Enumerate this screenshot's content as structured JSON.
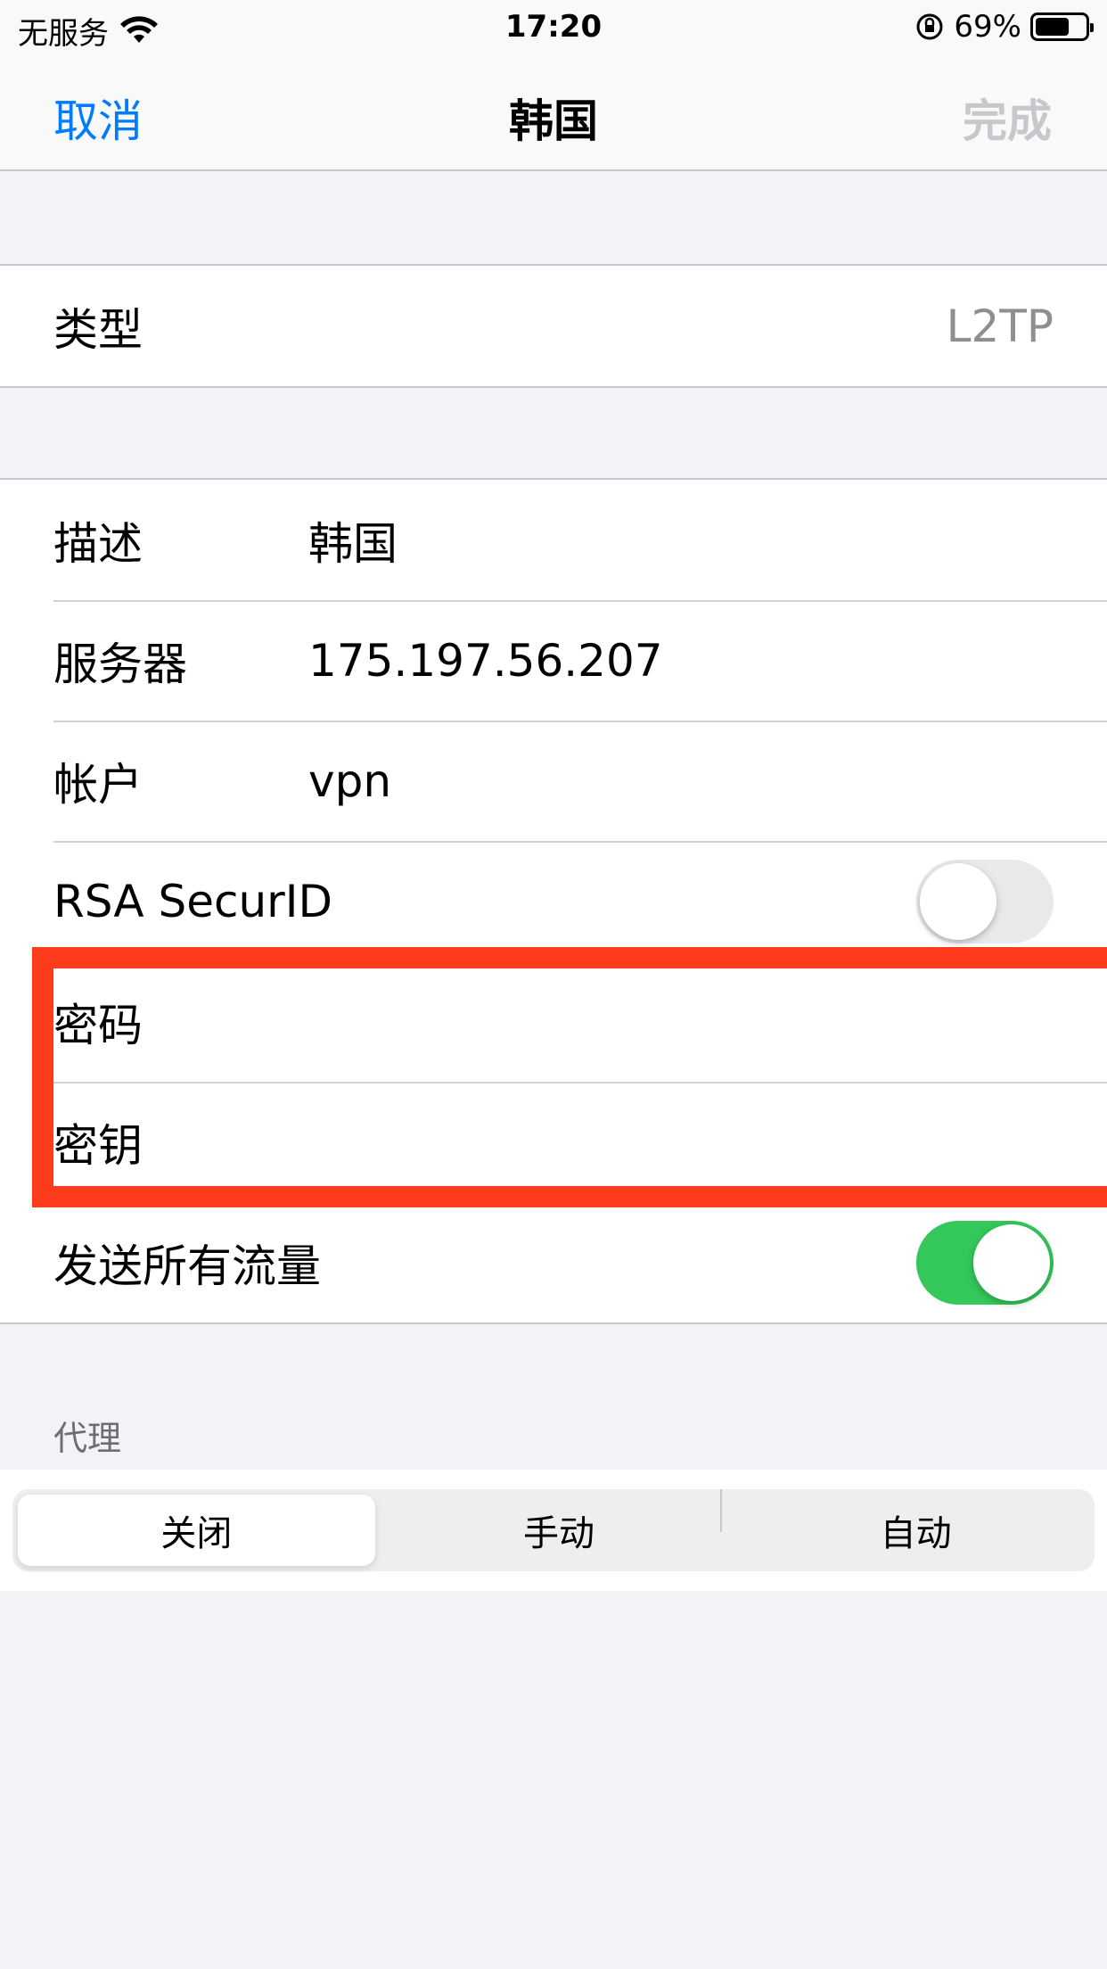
{
  "status_bar": {
    "carrier": "无服务",
    "time": "17:20",
    "battery_percent": "69%",
    "battery_level": 0.69
  },
  "nav": {
    "cancel": "取消",
    "title": "韩国",
    "done": "完成"
  },
  "type_row": {
    "label": "类型",
    "value": "L2TP"
  },
  "fields": {
    "description": {
      "label": "描述",
      "value": "韩国"
    },
    "server": {
      "label": "服务器",
      "value": "175.197.56.207"
    },
    "account": {
      "label": "帐户",
      "value": "vpn"
    },
    "rsa": {
      "label": "RSA SecurID",
      "on": false
    },
    "password": {
      "label": "密码",
      "value": ""
    },
    "secret": {
      "label": "密钥",
      "value": ""
    },
    "send_all_traffic": {
      "label": "发送所有流量",
      "on": true
    }
  },
  "proxy": {
    "header": "代理",
    "options": [
      "关闭",
      "手动",
      "自动"
    ],
    "selected": "关闭"
  },
  "colors": {
    "accent": "#007aff",
    "toggle_on": "#34c759",
    "highlight_box": "#ff3b1d"
  }
}
